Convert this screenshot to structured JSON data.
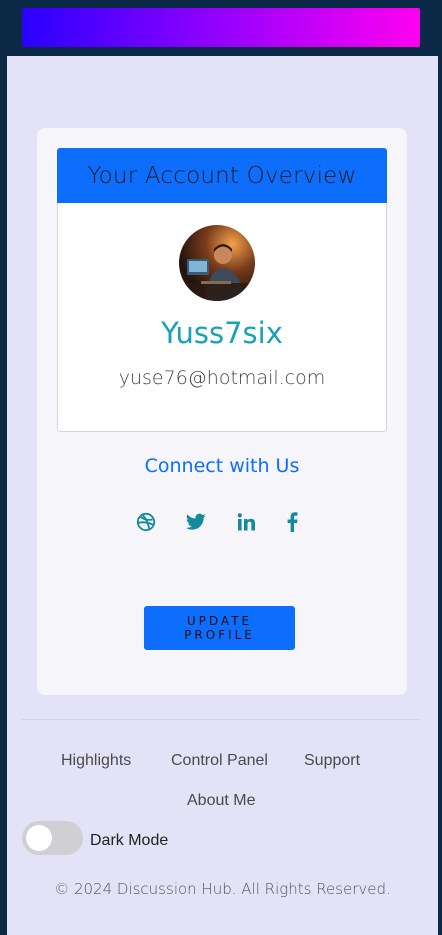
{
  "account": {
    "title": "Your Account Overview",
    "username": "Yuss7six",
    "email": "yuse76@hotmail.com",
    "avatar_alt": "user-avatar"
  },
  "social": {
    "heading": "Connect with Us",
    "icons": [
      "dribbble-icon",
      "twitter-icon",
      "linkedin-icon",
      "facebook-icon"
    ]
  },
  "actions": {
    "update_label": "UPDATE PROFILE"
  },
  "footer": {
    "links": [
      "Highlights",
      "Control Panel",
      "Support",
      "About Me"
    ],
    "dark_mode_label": "Dark Mode",
    "dark_mode_on": false,
    "copyright": "© 2024 Discussion Hub. All Rights Reserved."
  },
  "colors": {
    "primary": "#0d6efd",
    "accent": "#17a2b8",
    "page_bg": "#e3e2f6",
    "banner_gradient_start": "#2a00ff",
    "banner_gradient_end": "#ff00f0"
  }
}
